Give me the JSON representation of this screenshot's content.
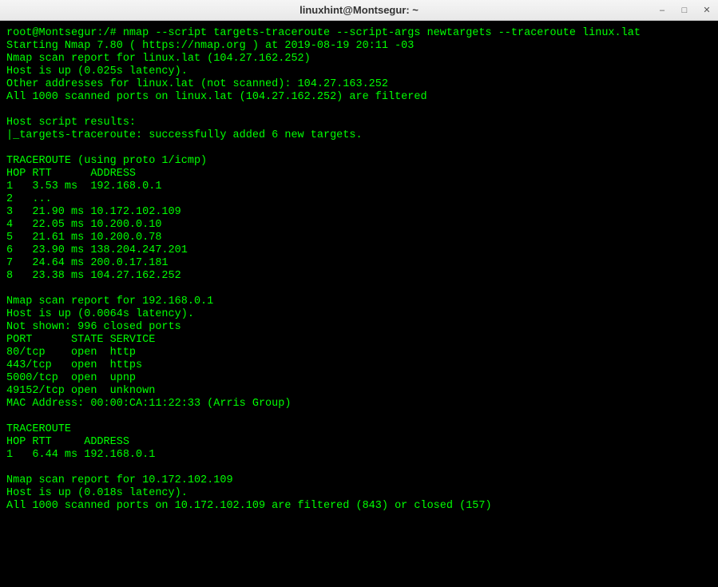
{
  "window": {
    "title": "linuxhint@Montsegur: ~"
  },
  "terminal": {
    "lines": [
      "root@Montsegur:/# nmap --script targets-traceroute --script-args newtargets --traceroute linux.lat",
      "Starting Nmap 7.80 ( https://nmap.org ) at 2019-08-19 20:11 -03",
      "Nmap scan report for linux.lat (104.27.162.252)",
      "Host is up (0.025s latency).",
      "Other addresses for linux.lat (not scanned): 104.27.163.252",
      "All 1000 scanned ports on linux.lat (104.27.162.252) are filtered",
      "",
      "Host script results:",
      "|_targets-traceroute: successfully added 6 new targets.",
      "",
      "TRACEROUTE (using proto 1/icmp)",
      "HOP RTT      ADDRESS",
      "1   3.53 ms  192.168.0.1",
      "2   ...",
      "3   21.90 ms 10.172.102.109",
      "4   22.05 ms 10.200.0.10",
      "5   21.61 ms 10.200.0.78",
      "6   23.90 ms 138.204.247.201",
      "7   24.64 ms 200.0.17.181",
      "8   23.38 ms 104.27.162.252",
      "",
      "Nmap scan report for 192.168.0.1",
      "Host is up (0.0064s latency).",
      "Not shown: 996 closed ports",
      "PORT      STATE SERVICE",
      "80/tcp    open  http",
      "443/tcp   open  https",
      "5000/tcp  open  upnp",
      "49152/tcp open  unknown",
      "MAC Address: 00:00:CA:11:22:33 (Arris Group)",
      "",
      "TRACEROUTE",
      "HOP RTT     ADDRESS",
      "1   6.44 ms 192.168.0.1",
      "",
      "Nmap scan report for 10.172.102.109",
      "Host is up (0.018s latency).",
      "All 1000 scanned ports on 10.172.102.109 are filtered (843) or closed (157)",
      ""
    ]
  }
}
